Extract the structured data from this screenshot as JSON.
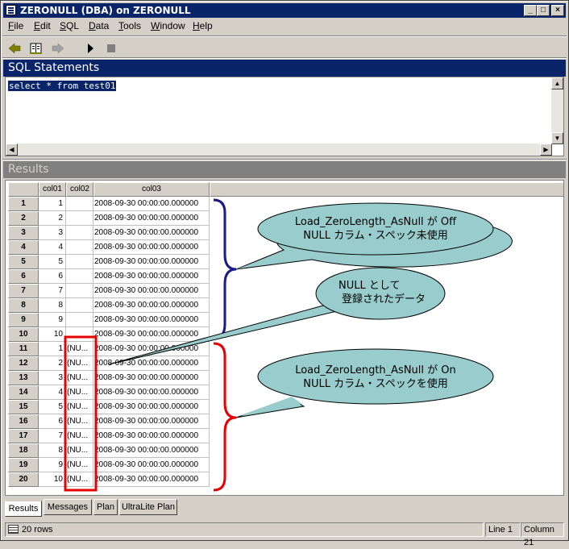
{
  "window": {
    "title": "ZERONULL (DBA) on ZERONULL",
    "controls": {
      "minimize": "_",
      "maximize": "□",
      "close": "×"
    }
  },
  "menu": {
    "items": [
      {
        "accel": "F",
        "rest": "ile"
      },
      {
        "accel": "E",
        "rest": "dit"
      },
      {
        "accel": "S",
        "rest": "QL"
      },
      {
        "accel": "D",
        "rest": "ata"
      },
      {
        "accel": "T",
        "rest": "ools"
      },
      {
        "accel": "W",
        "rest": "indow"
      },
      {
        "accel": "H",
        "rest": "elp"
      }
    ]
  },
  "toolbar": {
    "icons": [
      "back-arrow-icon",
      "history-book-icon",
      "forward-arrow-icon",
      "execute-play-icon",
      "stop-icon"
    ]
  },
  "sql_panel": {
    "header": "SQL Statements",
    "statement": "select * from test01"
  },
  "results_panel": {
    "header": "Results",
    "columns": [
      "col01",
      "col02",
      "col03"
    ],
    "rows": [
      {
        "n": "1",
        "col01": "1",
        "col02": "",
        "col03": "2008-09-30 00:00:00.000000"
      },
      {
        "n": "2",
        "col01": "2",
        "col02": "",
        "col03": "2008-09-30 00:00:00.000000"
      },
      {
        "n": "3",
        "col01": "3",
        "col02": "",
        "col03": "2008-09-30 00:00:00.000000"
      },
      {
        "n": "4",
        "col01": "4",
        "col02": "",
        "col03": "2008-09-30 00:00:00.000000"
      },
      {
        "n": "5",
        "col01": "5",
        "col02": "",
        "col03": "2008-09-30 00:00:00.000000"
      },
      {
        "n": "6",
        "col01": "6",
        "col02": "",
        "col03": "2008-09-30 00:00:00.000000"
      },
      {
        "n": "7",
        "col01": "7",
        "col02": "",
        "col03": "2008-09-30 00:00:00.000000"
      },
      {
        "n": "8",
        "col01": "8",
        "col02": "",
        "col03": "2008-09-30 00:00:00.000000"
      },
      {
        "n": "9",
        "col01": "9",
        "col02": "",
        "col03": "2008-09-30 00:00:00.000000"
      },
      {
        "n": "10",
        "col01": "10",
        "col02": "",
        "col03": "2008-09-30 00:00:00.000000"
      },
      {
        "n": "11",
        "col01": "1",
        "col02": "(NU...",
        "col03": "2008-09-30 00:00:00.000000"
      },
      {
        "n": "12",
        "col01": "2",
        "col02": "(NU...",
        "col03": "2008-09-30 00:00:00.000000"
      },
      {
        "n": "13",
        "col01": "3",
        "col02": "(NU...",
        "col03": "2008-09-30 00:00:00.000000"
      },
      {
        "n": "14",
        "col01": "4",
        "col02": "(NU...",
        "col03": "2008-09-30 00:00:00.000000"
      },
      {
        "n": "15",
        "col01": "5",
        "col02": "(NU...",
        "col03": "2008-09-30 00:00:00.000000"
      },
      {
        "n": "16",
        "col01": "6",
        "col02": "(NU...",
        "col03": "2008-09-30 00:00:00.000000"
      },
      {
        "n": "17",
        "col01": "7",
        "col02": "(NU...",
        "col03": "2008-09-30 00:00:00.000000"
      },
      {
        "n": "18",
        "col01": "8",
        "col02": "(NU...",
        "col03": "2008-09-30 00:00:00.000000"
      },
      {
        "n": "19",
        "col01": "9",
        "col02": "(NU...",
        "col03": "2008-09-30 00:00:00.000000"
      },
      {
        "n": "20",
        "col01": "10",
        "col02": "(NU...",
        "col03": "2008-09-30 00:00:00.000000"
      }
    ]
  },
  "annotations": {
    "callout_off": {
      "line1": "Load_ZeroLength_AsNull が Off",
      "line2": "NULL カラム・スペック未使用"
    },
    "callout_null": {
      "line1": "NULL として",
      "line2": "登録されたデータ"
    },
    "callout_on": {
      "line1": "Load_ZeroLength_AsNull が On",
      "line2": "NULL カラム・スペックを使用"
    },
    "colors": {
      "callout_fill": "#99cccc",
      "brace_top": "#1a1a8c",
      "brace_bottom": "#e60000",
      "highlight_box": "#e60000"
    }
  },
  "tabs": [
    "Results",
    "Messages",
    "Plan",
    "UltraLite Plan"
  ],
  "status": {
    "rows": "20 rows",
    "line": "Line 1",
    "column": "Column 21"
  },
  "colors": {
    "titlebar": "#0a246a",
    "sql_header": "#0a246a",
    "results_header": "#808080",
    "face": "#d4d0c8"
  }
}
